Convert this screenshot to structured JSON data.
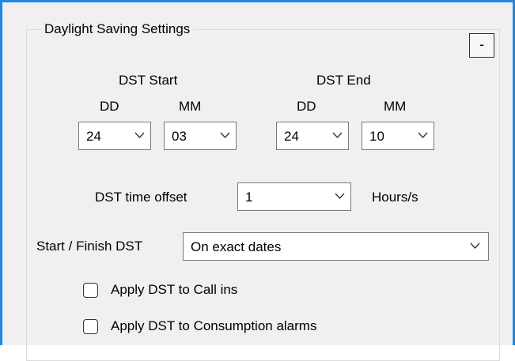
{
  "group": {
    "title": "Daylight Saving Settings",
    "collapse_label": "-"
  },
  "dst_start": {
    "title": "DST Start",
    "dd_label": "DD",
    "mm_label": "MM",
    "dd_value": "24",
    "mm_value": "03"
  },
  "dst_end": {
    "title": "DST End",
    "dd_label": "DD",
    "mm_label": "MM",
    "dd_value": "24",
    "mm_value": "10"
  },
  "offset": {
    "label": "DST time offset",
    "value": "1",
    "unit": "Hours/s"
  },
  "start_finish": {
    "label": "Start / Finish DST",
    "value": "On exact dates"
  },
  "checkboxes": [
    {
      "label": "Apply DST to Call ins",
      "checked": false
    },
    {
      "label": "Apply DST to Consumption alarms",
      "checked": false
    }
  ],
  "icons": {
    "dropdown": "chevron-down-icon"
  },
  "colors": {
    "window_border": "#1e88e5",
    "panel_bg": "#f0f0f0"
  }
}
